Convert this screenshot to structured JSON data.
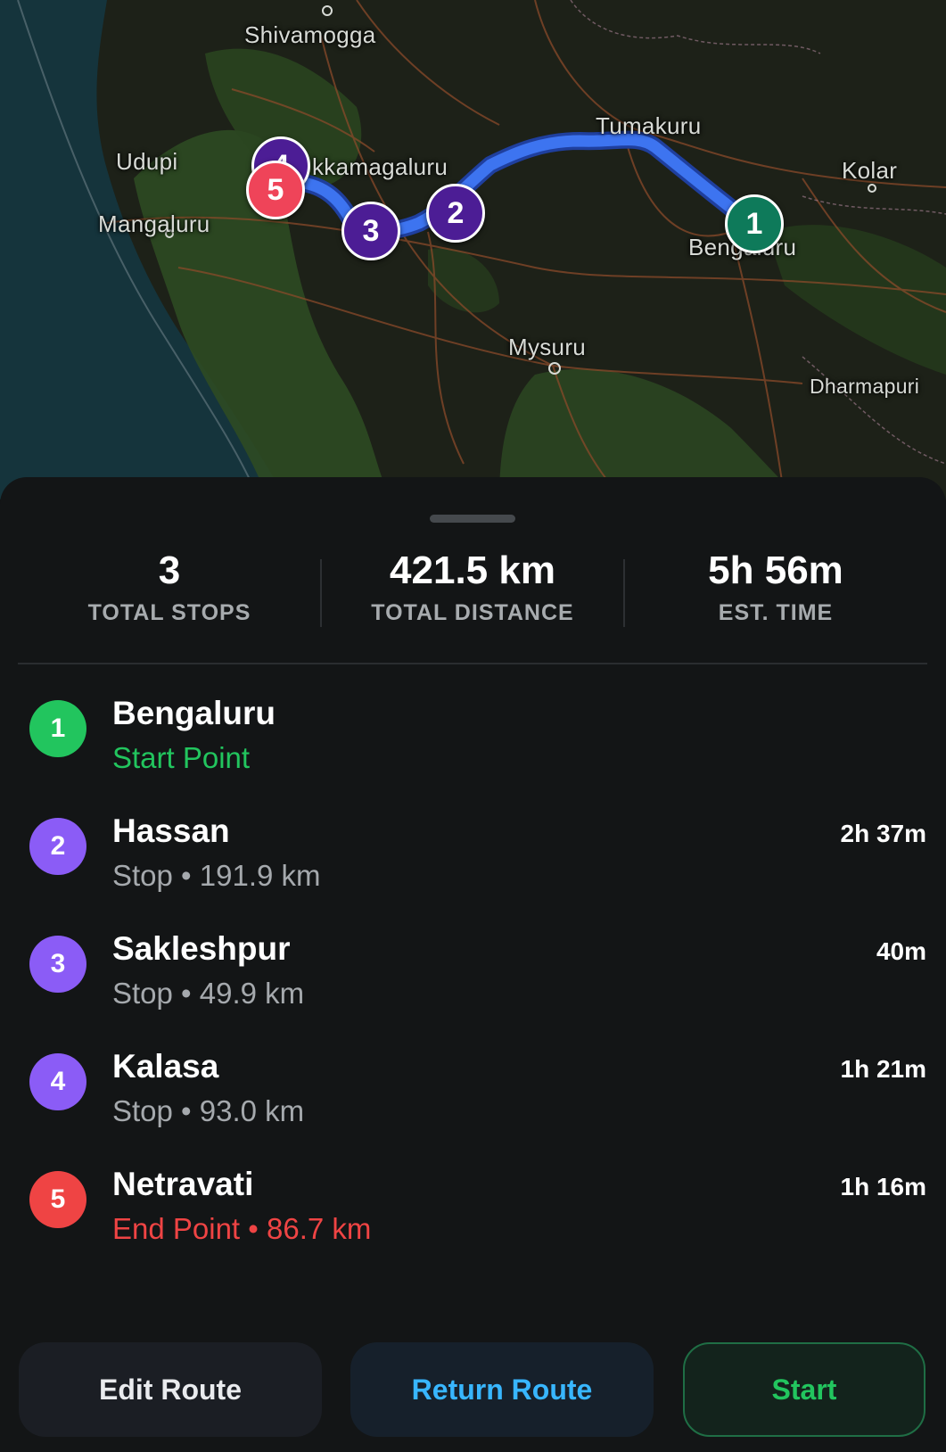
{
  "map": {
    "labels": {
      "shivamogga": "Shivamogga",
      "udupi": "Udupi",
      "chikkamagaluru": "kkamagaluru",
      "mangaluru": "Mangaluru",
      "tumakuru": "Tumakuru",
      "kolar": "Kolar",
      "bengaluru": "Bengaluru",
      "mysuru": "Mysuru",
      "dharmapuri": "Dharmapuri"
    },
    "markers": [
      "1",
      "2",
      "3",
      "4",
      "5"
    ],
    "route_color": "#3d74f0"
  },
  "summary": {
    "stops_value": "3",
    "stops_label": "TOTAL STOPS",
    "distance_value": "421.5 km",
    "distance_label": "TOTAL DISTANCE",
    "time_value": "5h 56m",
    "time_label": "EST. TIME"
  },
  "stops": [
    {
      "num": "1",
      "name": "Bengaluru",
      "sub": "Start Point",
      "time": ""
    },
    {
      "num": "2",
      "name": "Hassan",
      "sub": "Stop • 191.9 km",
      "time": "2h 37m"
    },
    {
      "num": "3",
      "name": "Sakleshpur",
      "sub": "Stop • 49.9 km",
      "time": "40m"
    },
    {
      "num": "4",
      "name": "Kalasa",
      "sub": "Stop • 93.0 km",
      "time": "1h 21m"
    },
    {
      "num": "5",
      "name": "Netravati",
      "sub": "End Point • 86.7 km",
      "time": "1h 16m"
    }
  ],
  "colors": {
    "start": "#22c55e",
    "stop": "#8b5cf6",
    "end": "#ef4444",
    "map_start_marker": "#0e7a5a",
    "map_stop_marker": "#4c1d95",
    "map_end_marker": "#ef4459",
    "return_route": "#38b6ff",
    "start_button": "#22c55e"
  },
  "buttons": {
    "edit": "Edit Route",
    "return": "Return Route",
    "start": "Start"
  }
}
